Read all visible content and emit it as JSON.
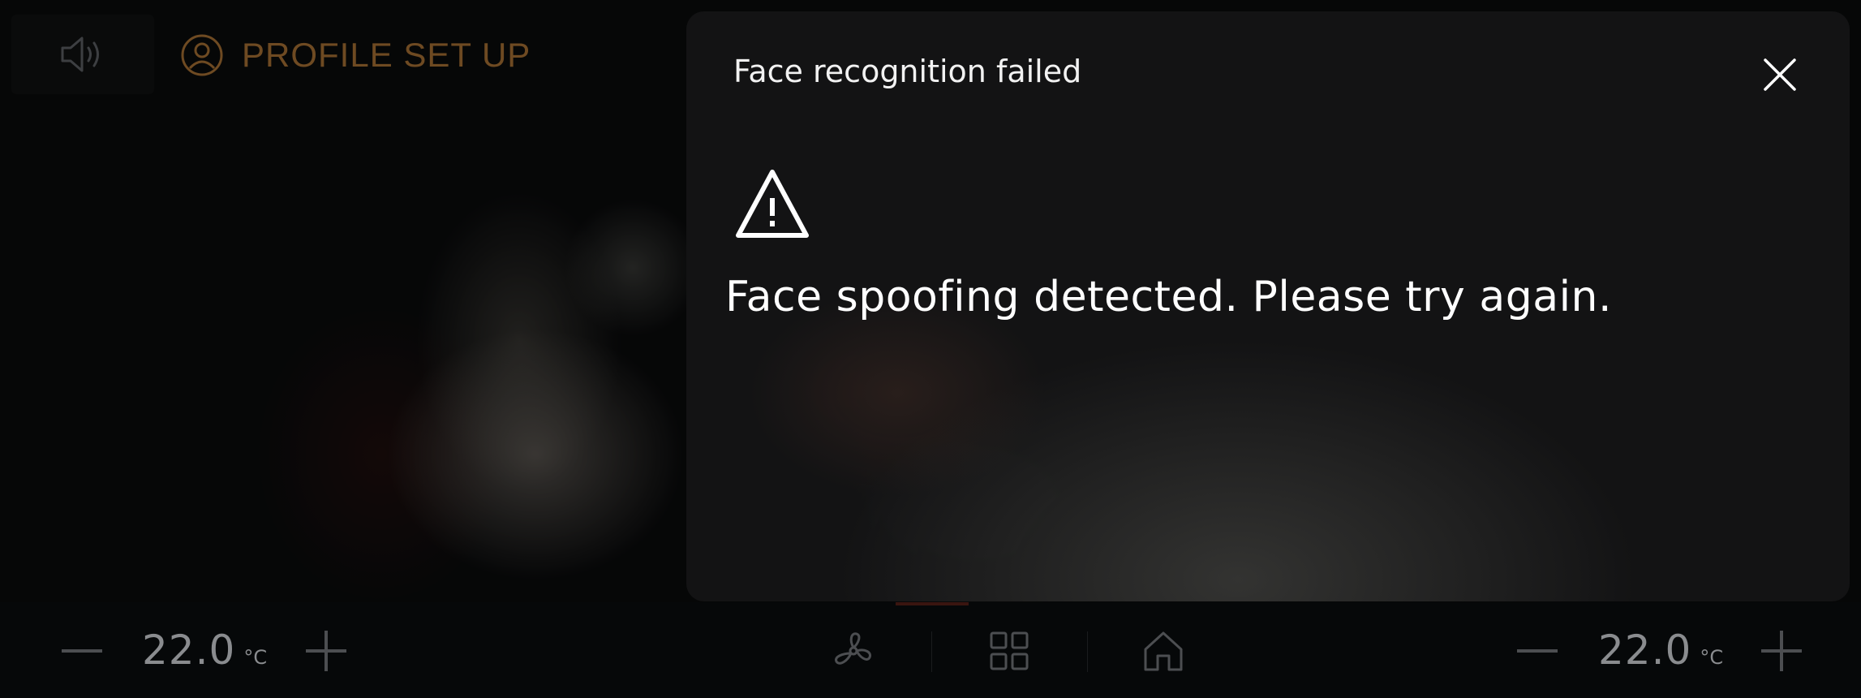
{
  "header": {
    "sound_icon": "speaker-icon",
    "profile_icon": "user-circle-icon",
    "profile_label": "PROFILE SET UP",
    "accent_color": "#6e4a22"
  },
  "dialog": {
    "title": "Face recognition failed",
    "close_icon": "close-icon",
    "warning_icon": "warning-triangle-icon",
    "message": "Face spoofing detected. Please try again."
  },
  "bottom_bar": {
    "left_temp": {
      "value": "22.0",
      "unit": "°C",
      "decrease_icon": "minus-icon",
      "increase_icon": "plus-icon"
    },
    "right_temp": {
      "value": "22.0",
      "unit": "°C",
      "decrease_icon": "minus-icon",
      "increase_icon": "plus-icon"
    },
    "center_icons": [
      "fan-icon",
      "apps-grid-icon",
      "home-icon"
    ]
  }
}
